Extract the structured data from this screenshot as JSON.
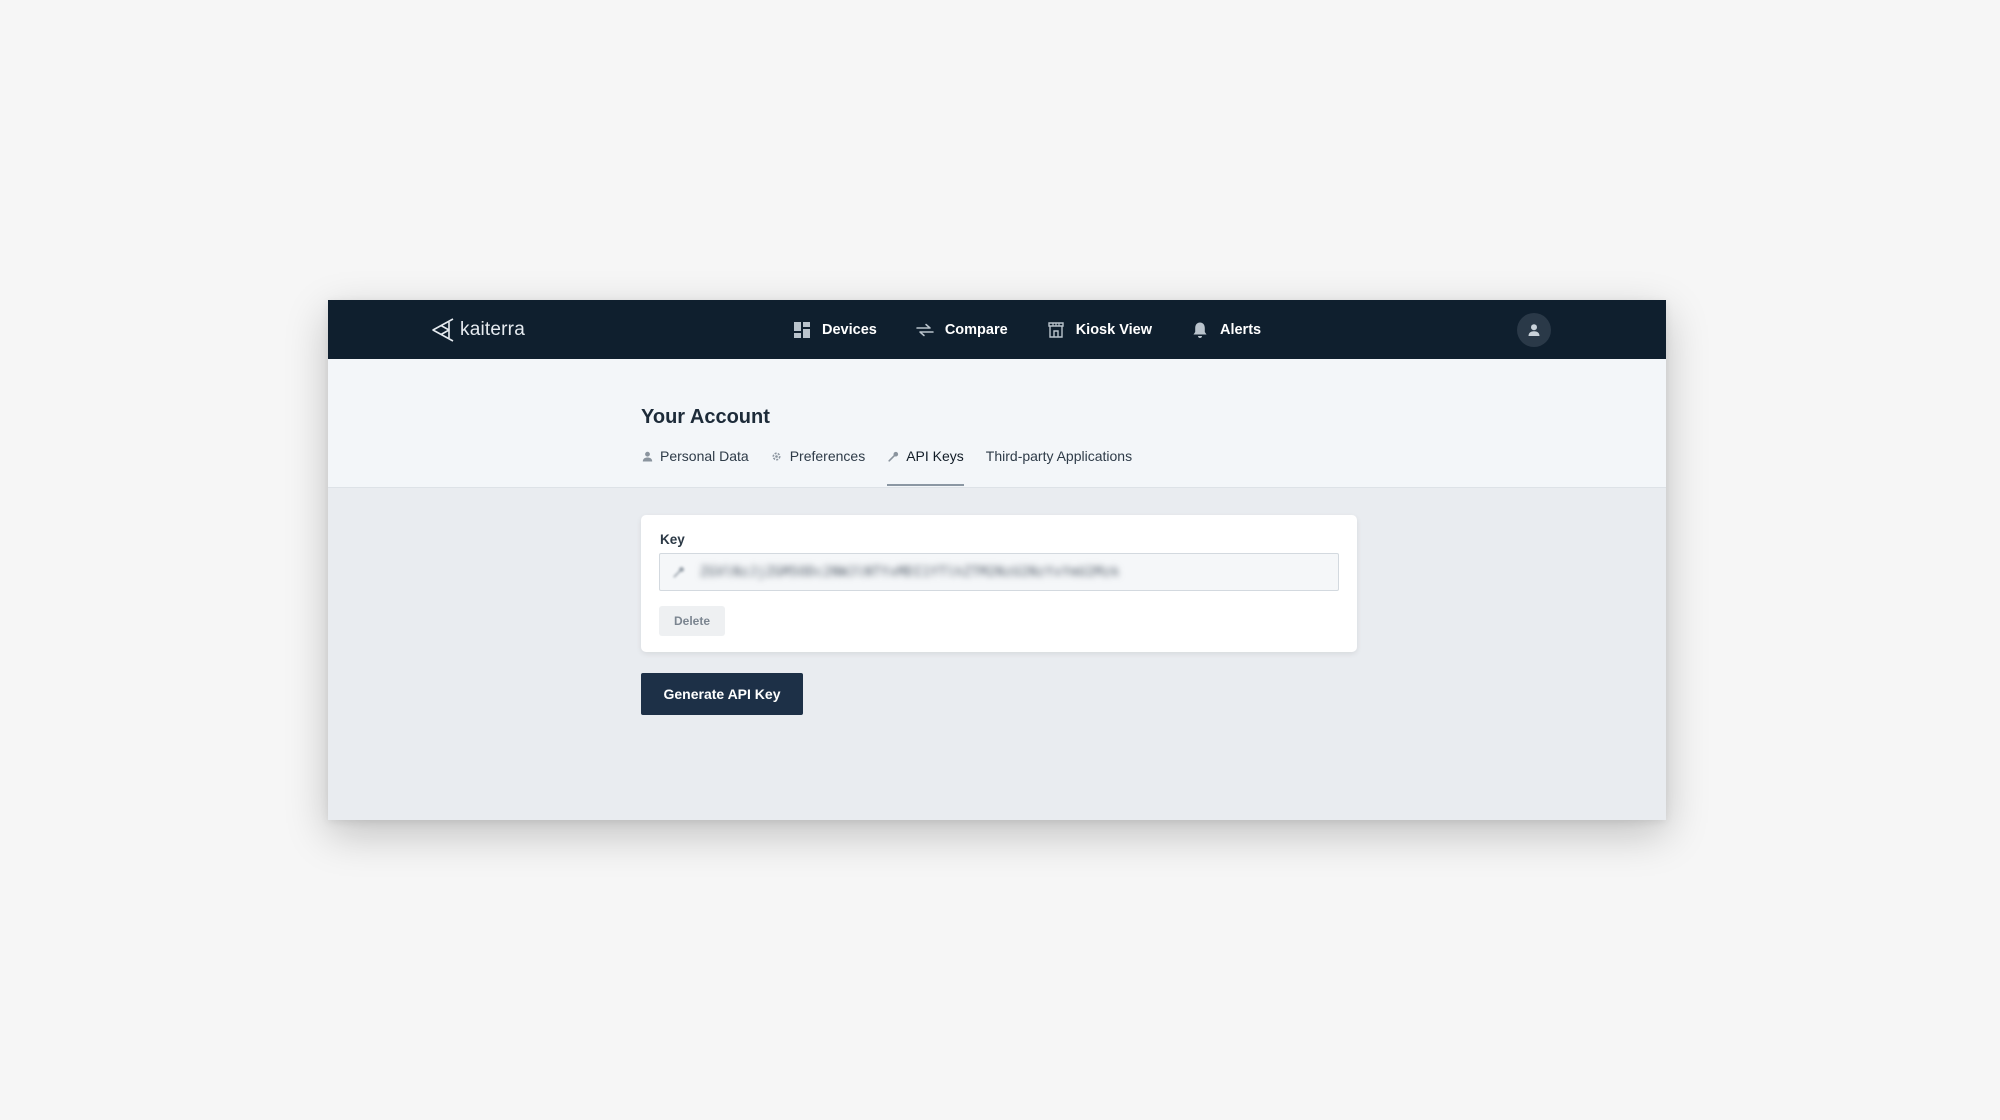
{
  "brand": {
    "name": "kaiterra",
    "icon": "kaiterra-logo-icon"
  },
  "nav": {
    "items": [
      {
        "label": "Devices",
        "icon": "grid-icon"
      },
      {
        "label": "Compare",
        "icon": "compare-arrows-icon"
      },
      {
        "label": "Kiosk View",
        "icon": "kiosk-icon"
      },
      {
        "label": "Alerts",
        "icon": "bell-icon"
      }
    ],
    "avatar_icon": "user-icon"
  },
  "account": {
    "title": "Your Account",
    "tabs": [
      {
        "label": "Personal Data",
        "icon": "person-icon",
        "active": false
      },
      {
        "label": "Preferences",
        "icon": "gear-icon",
        "active": false
      },
      {
        "label": "API Keys",
        "icon": "key-icon",
        "active": true
      },
      {
        "label": "Third-party Applications",
        "icon": "",
        "active": false
      }
    ]
  },
  "api_key_card": {
    "label": "Key",
    "value": "ZGVlNzJjZGM5ODc2NWJlNTYxMDI1YTlhZTM2NzU2NzYxYmU2Mzk",
    "key_icon": "key-icon",
    "delete_label": "Delete"
  },
  "actions": {
    "generate_label": "Generate API Key"
  },
  "colors": {
    "navbar_bg": "#0f1f2e",
    "primary_button": "#1d3047",
    "page_bg": "#e9ecf0",
    "header_bg": "#f3f6f9"
  }
}
